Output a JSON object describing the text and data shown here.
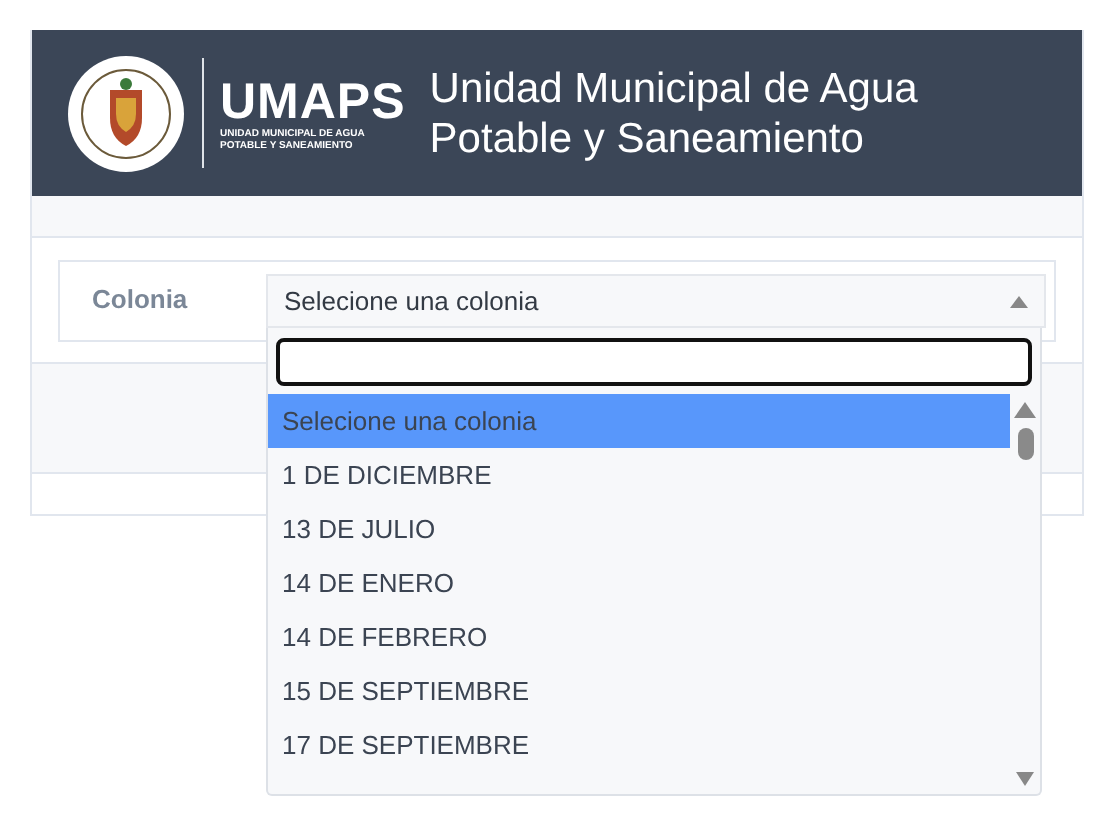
{
  "header": {
    "logo_text": "UMAPS",
    "logo_subtitle": [
      "UNIDAD MUNICIPAL DE AGUA",
      "POTABLE Y SANEAMIENTO"
    ],
    "title": "Unidad Municipal de Agua Potable y Saneamiento"
  },
  "form": {
    "label": "Colonia",
    "select": {
      "value": "Selecione una colonia",
      "expanded": true,
      "options": [
        {
          "label": "Selecione una colonia",
          "selected": true
        },
        {
          "label": "1 DE DICIEMBRE",
          "selected": false
        },
        {
          "label": "13 DE JULIO",
          "selected": false
        },
        {
          "label": "14 DE ENERO",
          "selected": false
        },
        {
          "label": "14 DE FEBRERO",
          "selected": false
        },
        {
          "label": "15 DE SEPTIEMBRE",
          "selected": false
        },
        {
          "label": "17 DE SEPTIEMBRE",
          "selected": false
        }
      ]
    }
  }
}
